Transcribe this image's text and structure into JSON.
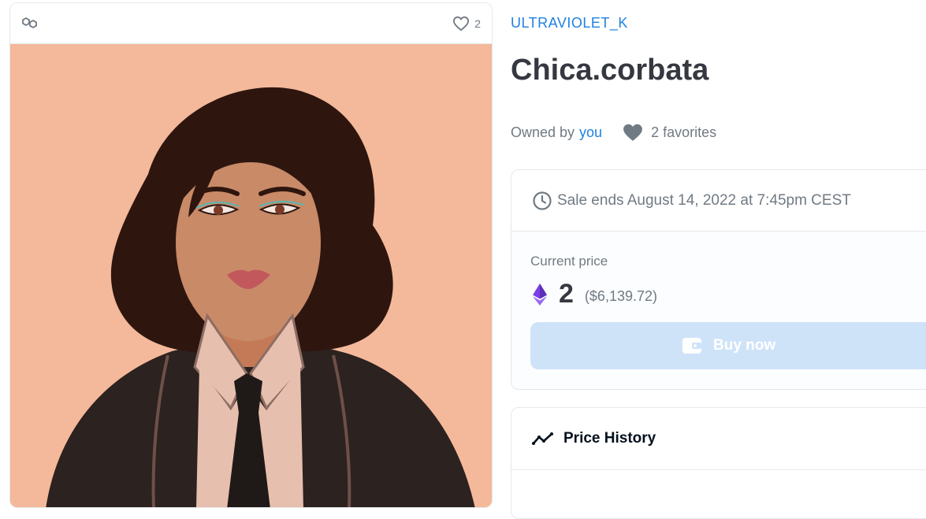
{
  "media": {
    "favorite_count": "2",
    "chain_icon": "polygon-chain-icon",
    "favorite_icon": "heart-outline-icon",
    "background_color": "#f4b99a"
  },
  "item": {
    "collection": "ULTRAVIOLET_K",
    "title": "Chica.corbata",
    "owned_by_label": "Owned by",
    "owner": "you",
    "favorites": "2 favorites"
  },
  "sale": {
    "ends": "Sale ends August 14, 2022 at 7:45pm CEST",
    "price_label": "Current price",
    "price": "2",
    "fiat": "($6,139.72)",
    "currency_icon": "ethereum-icon",
    "buy_label": "Buy now",
    "buy_icon": "wallet-icon"
  },
  "history": {
    "title": "Price History",
    "icon": "trending-line-icon"
  },
  "colors": {
    "accent": "#2081e2",
    "text": "#353840",
    "muted": "#707a83",
    "buy_button": "#cfe3f8",
    "eth": "#7b3fe4"
  }
}
